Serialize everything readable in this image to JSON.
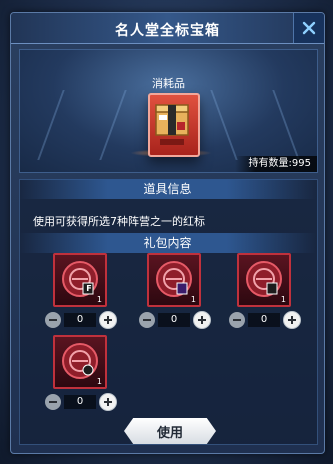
{
  "dialog": {
    "title": "名人堂全标宝箱"
  },
  "item": {
    "category": "消耗品",
    "owned_label": "持有数量:995"
  },
  "info": {
    "header": "道具信息",
    "description": "使用可获得所选7种阵营之一的红标"
  },
  "gifts": {
    "header": "礼包内容",
    "items": [
      {
        "count": "1",
        "emblem": "F",
        "quantity": "0"
      },
      {
        "count": "1",
        "emblem": "",
        "quantity": "0"
      },
      {
        "count": "1",
        "emblem": "",
        "quantity": "0"
      },
      {
        "count": "1",
        "emblem": "",
        "quantity": "0"
      }
    ]
  },
  "actions": {
    "use_label": "使用"
  },
  "colors": {
    "accent_red": "#c0313c",
    "panel_blue": "#2a3f60",
    "header_blue": "#2e5790"
  }
}
